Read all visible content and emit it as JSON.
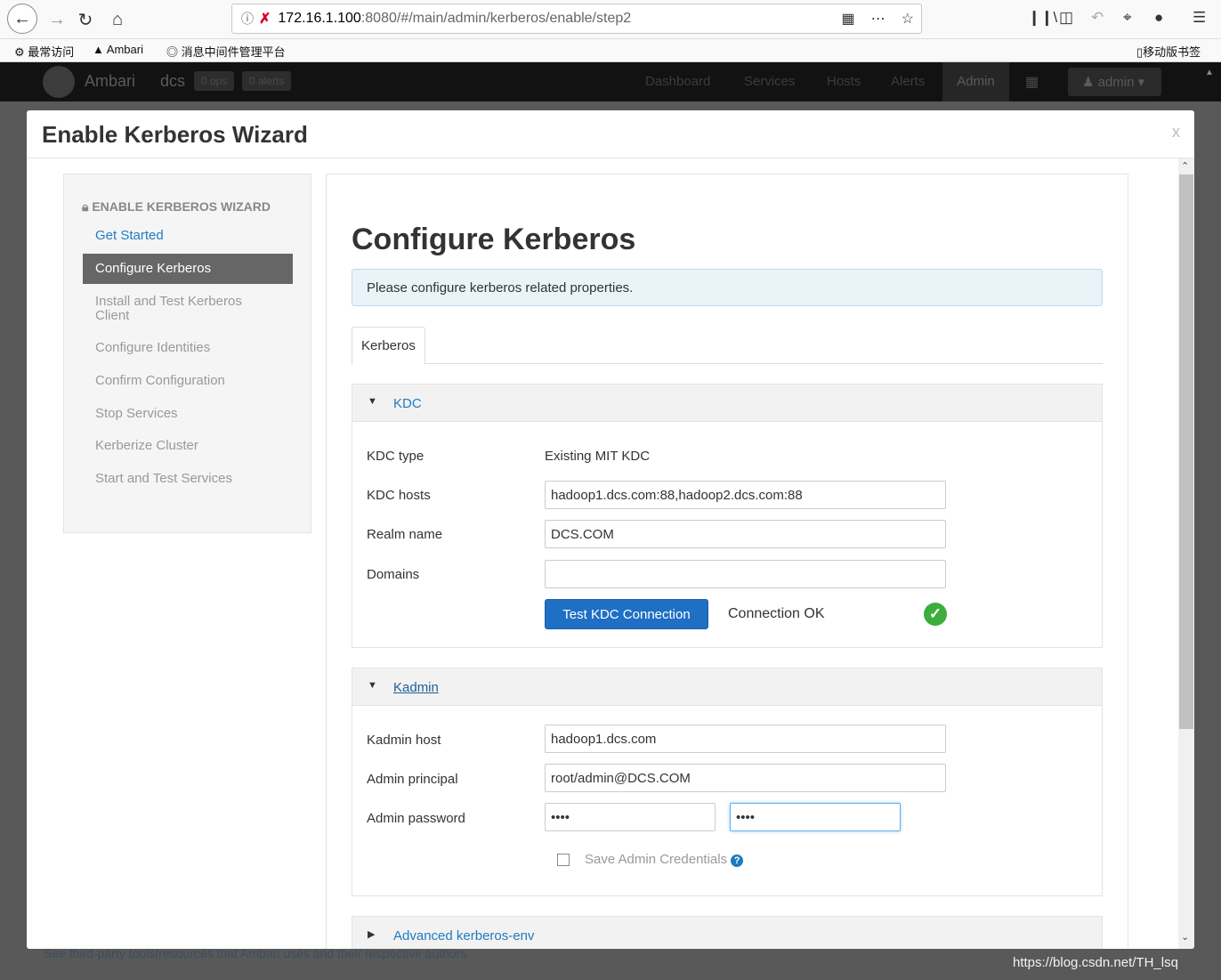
{
  "browser": {
    "url_host": "172.16.1.100",
    "url_path": ":8080/#/main/admin/kerberos/enable/step2",
    "bookmarks": [
      "最常访问",
      "Ambari",
      "消息中间件管理平台"
    ],
    "mobile_bookmarks": "移动版书签"
  },
  "ambari": {
    "brand": "Ambari",
    "cluster": "dcs",
    "ops_badge": "0 ops",
    "alerts_badge": "0 alerts",
    "nav": [
      "Dashboard",
      "Services",
      "Hosts",
      "Alerts"
    ],
    "admin_tab": "Admin",
    "user_menu": "admin",
    "footer": "See third-party tools/resources that Ambari uses and their respective authors"
  },
  "watermark": "https://blog.csdn.net/TH_lsq",
  "modal": {
    "title": "Enable Kerberos Wizard",
    "close": "x"
  },
  "wizard": {
    "header": "ENABLE KERBEROS WIZARD",
    "steps": [
      "Get Started",
      "Configure Kerberos",
      "Install and Test Kerberos Client",
      "Configure Identities",
      "Confirm Configuration",
      "Stop Services",
      "Kerberize Cluster",
      "Start and Test Services"
    ]
  },
  "main": {
    "title": "Configure Kerberos",
    "info": "Please configure kerberos related properties.",
    "tab": "Kerberos",
    "kdc": {
      "title": "KDC",
      "type_label": "KDC type",
      "type_value": "Existing MIT KDC",
      "hosts_label": "KDC hosts",
      "hosts_value": "hadoop1.dcs.com:88,hadoop2.dcs.com:88",
      "realm_label": "Realm name",
      "realm_value": "DCS.COM",
      "domains_label": "Domains",
      "domains_value": "",
      "test_button": "Test KDC Connection",
      "status": "Connection OK"
    },
    "kadmin": {
      "title": "Kadmin",
      "host_label": "Kadmin host",
      "host_value": "hadoop1.dcs.com",
      "principal_label": "Admin principal",
      "principal_value": "root/admin@DCS.COM",
      "password_label": "Admin password",
      "password_value": "••••",
      "confirm_value": "••••",
      "save_label": "Save Admin Credentials"
    },
    "advanced": {
      "title": "Advanced kerberos-env"
    }
  }
}
